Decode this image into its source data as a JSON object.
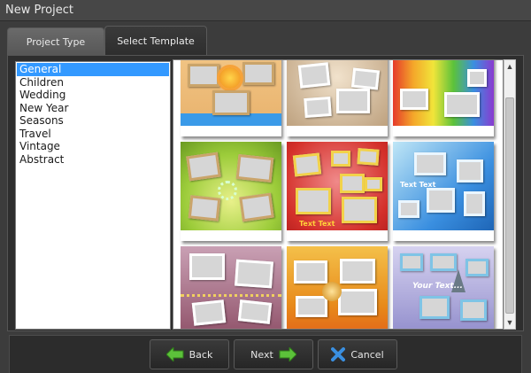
{
  "window": {
    "title": "New Project"
  },
  "tabs": [
    {
      "label": "Project Type",
      "active": false
    },
    {
      "label": "Select Template",
      "active": true
    }
  ],
  "categories": {
    "selected": "General",
    "items": [
      "General",
      "Children",
      "Wedding",
      "New Year",
      "Seasons",
      "Travel",
      "Vintage",
      "Abstract"
    ]
  },
  "templates": {
    "text_text": "Text Text",
    "your_text": "Your Text..."
  },
  "buttons": {
    "back": "Back",
    "next": "Next",
    "cancel": "Cancel"
  },
  "icons": {
    "back": "arrow-left-icon",
    "next": "arrow-right-icon",
    "cancel": "x-cross-icon"
  },
  "colors": {
    "selection": "#3399ff",
    "arrow_green": "#5cc23a",
    "cancel_blue": "#3a8fe0"
  }
}
